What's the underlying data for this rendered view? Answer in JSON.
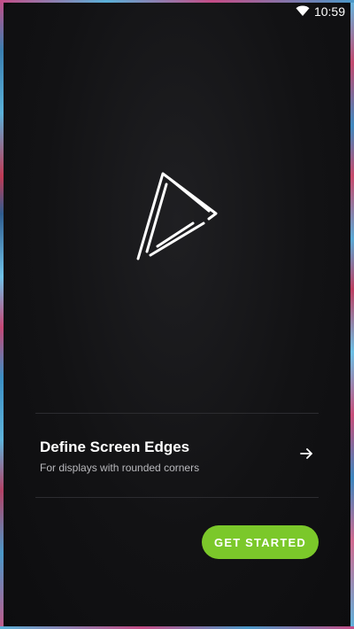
{
  "status_bar": {
    "time": "10:59",
    "wifi_icon": "wifi-icon"
  },
  "logo": {
    "icon": "triangle-play-logo"
  },
  "option": {
    "title": "Define Screen Edges",
    "subtitle": "For displays with rounded corners",
    "arrow_icon": "arrow-right-icon"
  },
  "actions": {
    "get_started_label": "GET STARTED"
  },
  "colors": {
    "background": "#0b0b0d",
    "accent": "#7bc82a",
    "text_primary": "#ffffff",
    "text_secondary": "#b9b9bd"
  }
}
